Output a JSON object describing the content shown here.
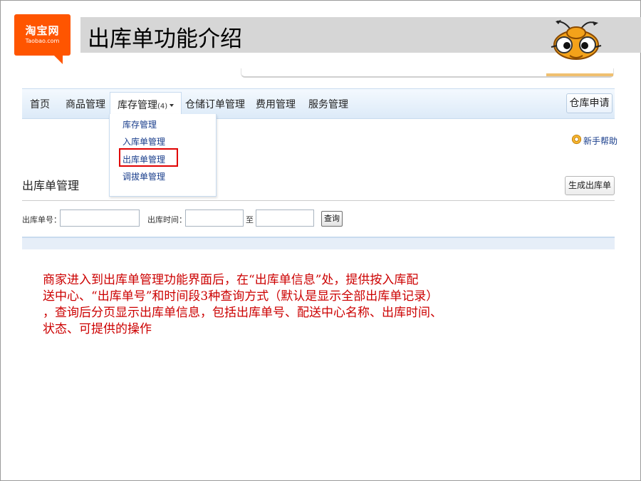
{
  "logo": {
    "cn": "淘宝网",
    "en": "Taobao.com"
  },
  "slide": {
    "title": "出库单功能介绍"
  },
  "nav": {
    "items": [
      {
        "label": "首页"
      },
      {
        "label": "商品管理"
      },
      {
        "label": "库存管理",
        "badge": "(4)"
      },
      {
        "label": "仓储订单管理"
      },
      {
        "label": "费用管理"
      },
      {
        "label": "服务管理"
      }
    ],
    "warehouse_apply_label": "仓库申请"
  },
  "dropdown": {
    "items": [
      {
        "label": "库存管理"
      },
      {
        "label": "入库单管理"
      },
      {
        "label": "出库单管理",
        "highlighted": true
      },
      {
        "label": "调拔单管理"
      }
    ]
  },
  "help": {
    "label": "新手帮助"
  },
  "section": {
    "title": "出库单管理",
    "create_button": "生成出库单"
  },
  "search": {
    "order_no_label": "出库单号：",
    "order_no_value": "",
    "time_label": "出库时间：",
    "time_from_value": "",
    "to_label": "至",
    "time_to_value": "",
    "query_button": "查询"
  },
  "description": {
    "lines": [
      "商家进入到出库单管理功能界面后，在“出库单信息”处，提供按入库配",
      "送中心、“出库单号”和时间段3种查询方式（默认是显示全部出库单记录）",
      "，查询后分页显示出库单信息，包括出库单号、配送中心名称、出库时间、",
      "状态、可提供的操作"
    ]
  },
  "colors": {
    "brand": "#ff5500",
    "description_text": "#cc0000",
    "link": "#1a3e8c",
    "highlight_box": "#e00000"
  }
}
